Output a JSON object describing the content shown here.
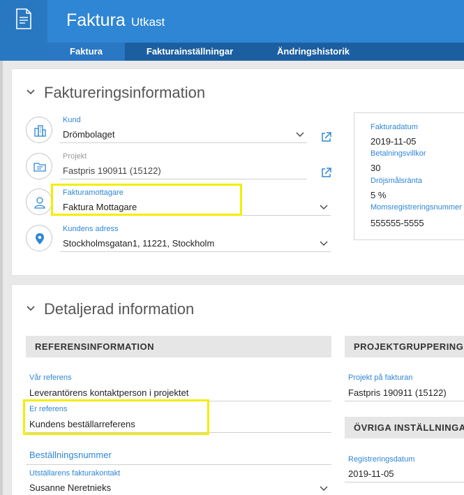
{
  "header": {
    "title": "Faktura",
    "status": "Utkast",
    "app_icon": "invoice-document-icon",
    "tabs": [
      {
        "label": "Faktura",
        "active": true
      },
      {
        "label": "Fakturainställningar",
        "active": false
      },
      {
        "label": "Ändringshistorik",
        "active": false
      }
    ],
    "colors": {
      "brand": "#2e86d4",
      "tabbar": "#1c5fa0",
      "highlight": "#f3ee00"
    }
  },
  "billing": {
    "heading": "Faktureringsinformation",
    "customer": {
      "label": "Kund",
      "value": "Drömbolaget"
    },
    "project": {
      "label": "Projekt",
      "value": "Fastpris 190911 (15122)"
    },
    "recipient": {
      "label": "Fakturamottagare",
      "value": "Faktura Mottagare"
    },
    "address": {
      "label": "Kundens adress",
      "value": "Stockholmsgatan1, 11221, Stockholm"
    },
    "info": {
      "invoice_date_label": "Fakturadatum",
      "invoice_date": "2019-11-05",
      "payment_terms_label": "Betalningsvillkor",
      "payment_terms": "30",
      "late_interest_label": "Dröjsmålsränta",
      "late_interest": "5 %",
      "vat_no_label": "Momsregistreringsnummer",
      "vat_no": "555555-5555"
    }
  },
  "details": {
    "heading": "Detaljerad information",
    "reference_section": "REFERENSINFORMATION",
    "our_reference": {
      "label": "Vår referens",
      "value": "Leverantörens kontaktperson i projektet"
    },
    "your_reference": {
      "label": "Er referens",
      "value": "Kundens beställarreferens"
    },
    "order_number_label": "Beställningsnummer",
    "issuer_contact": {
      "label": "Utställarens fakturakontakt",
      "value": "Susanne Neretnieks"
    },
    "project_group_section": "PROJEKTGRUPPERING",
    "project_on_invoice": {
      "label": "Projekt på fakturan",
      "value": "Fastpris 190911 (15122)"
    },
    "other_settings_section": "ÖVRIGA INSTÄLLNINGAR",
    "registration_date": {
      "label": "Registreringsdatum",
      "value": "2019-11-05"
    }
  }
}
